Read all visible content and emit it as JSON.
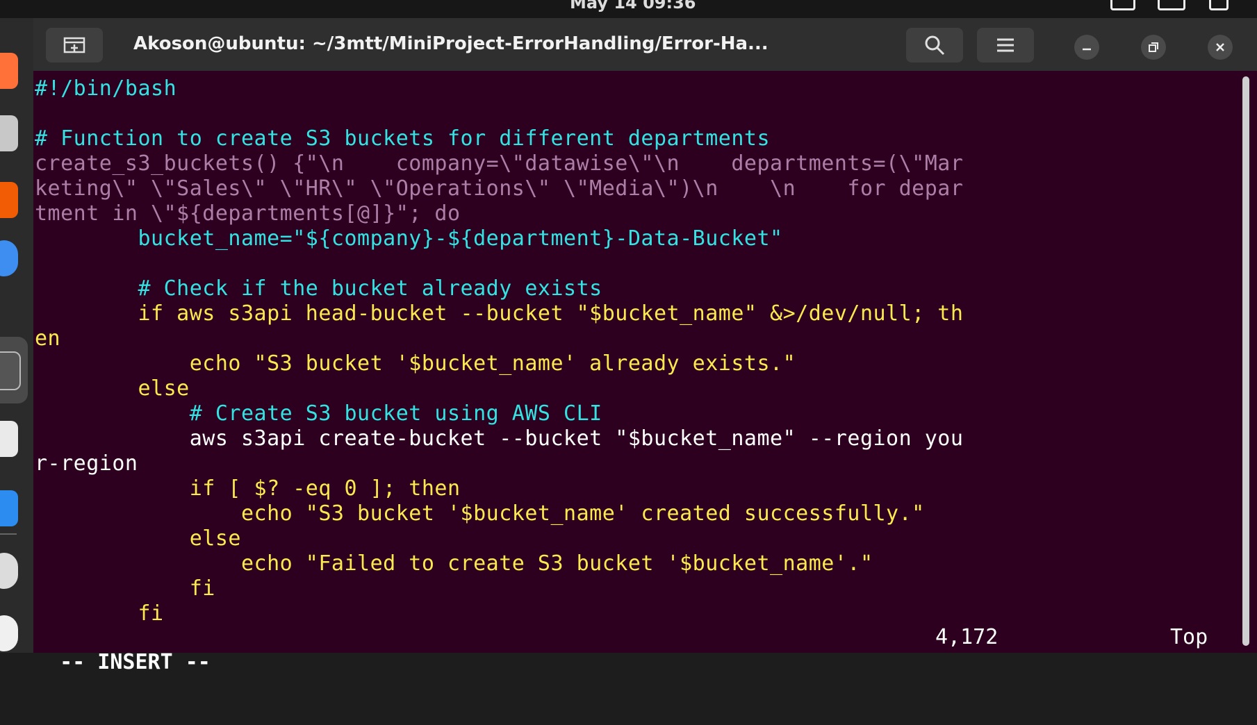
{
  "top_bar": {
    "clock": "May 14 09:36"
  },
  "window": {
    "title": "Akoson@ubuntu: ~/3mtt/MiniProject-ErrorHandling/Error-Ha..."
  },
  "editor": {
    "lines": [
      "#!/bin/bash",
      "",
      "# Function to create S3 buckets for different departments",
      "create_s3_buckets() {\"\\n    company=\\\"datawise\\\"\\n    departments=(\\\"Mar",
      "keting\\\" \\\"Sales\\\" \\\"HR\\\" \\\"Operations\\\" \\\"Media\\\")\\n    \\n    for depar",
      "tment in \\\"${departments[@]}\"; do",
      "        bucket_name=\"${company}-${department}-Data-Bucket\"",
      "",
      "        # Check if the bucket already exists",
      "        if aws s3api head-bucket --bucket \"$bucket_name\" &>/dev/null; th",
      "en",
      "            echo \"S3 bucket '$bucket_name' already exists.\"",
      "        else",
      "            # Create S3 bucket using AWS CLI",
      "            aws s3api create-bucket --bucket \"$bucket_name\" --region you",
      "r-region",
      "            if [ $? -eq 0 ]; then",
      "                echo \"S3 bucket '$bucket_name' created successfully.\"",
      "            else",
      "                echo \"Failed to create S3 bucket '$bucket_name'.\"",
      "            fi",
      "        fi"
    ],
    "status": {
      "mode": "-- INSERT --",
      "position": "4,172",
      "scroll": "Top"
    }
  }
}
